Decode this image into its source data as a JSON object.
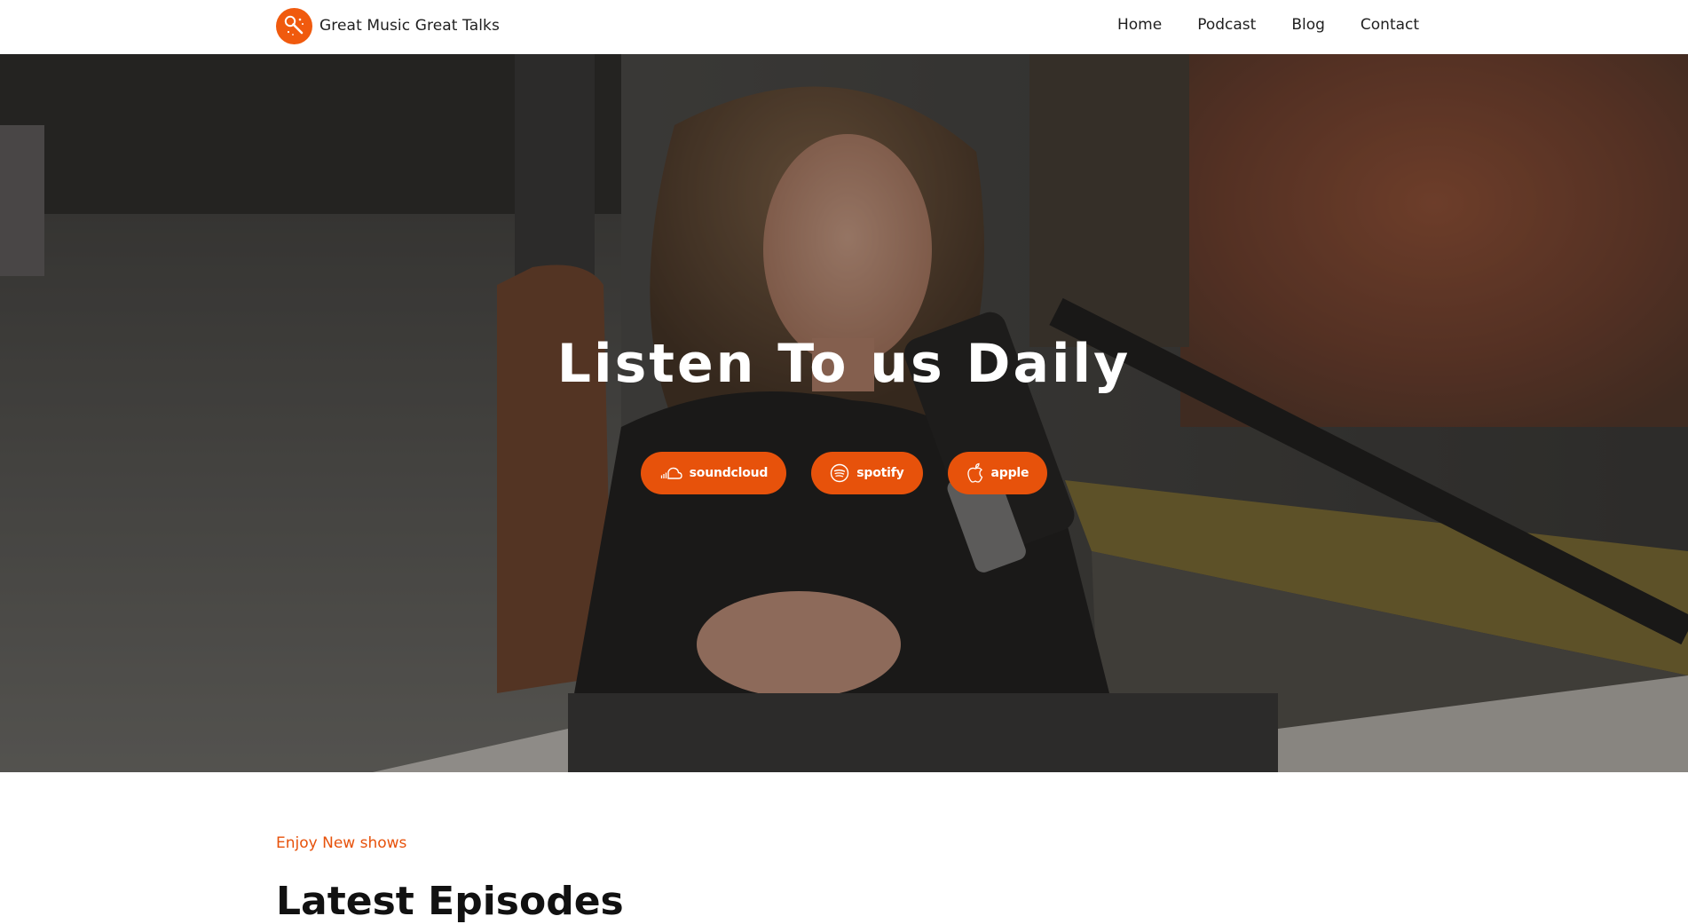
{
  "colors": {
    "accent": "#e7520b",
    "text": "#1f1f1f",
    "white": "#ffffff"
  },
  "header": {
    "brand": {
      "logo_icon": "microphone-icon",
      "name": "Great Music Great Talks"
    },
    "nav": [
      {
        "label": "Home"
      },
      {
        "label": "Podcast"
      },
      {
        "label": "Blog"
      },
      {
        "label": "Contact"
      }
    ]
  },
  "hero": {
    "title": "Listen To us Daily",
    "platforms": [
      {
        "label": "soundcloud",
        "icon": "soundcloud-icon"
      },
      {
        "label": "spotify",
        "icon": "spotify-icon"
      },
      {
        "label": "apple",
        "icon": "apple-icon"
      }
    ]
  },
  "section": {
    "eyebrow": "Enjoy New shows",
    "title": "Latest Episodes"
  }
}
